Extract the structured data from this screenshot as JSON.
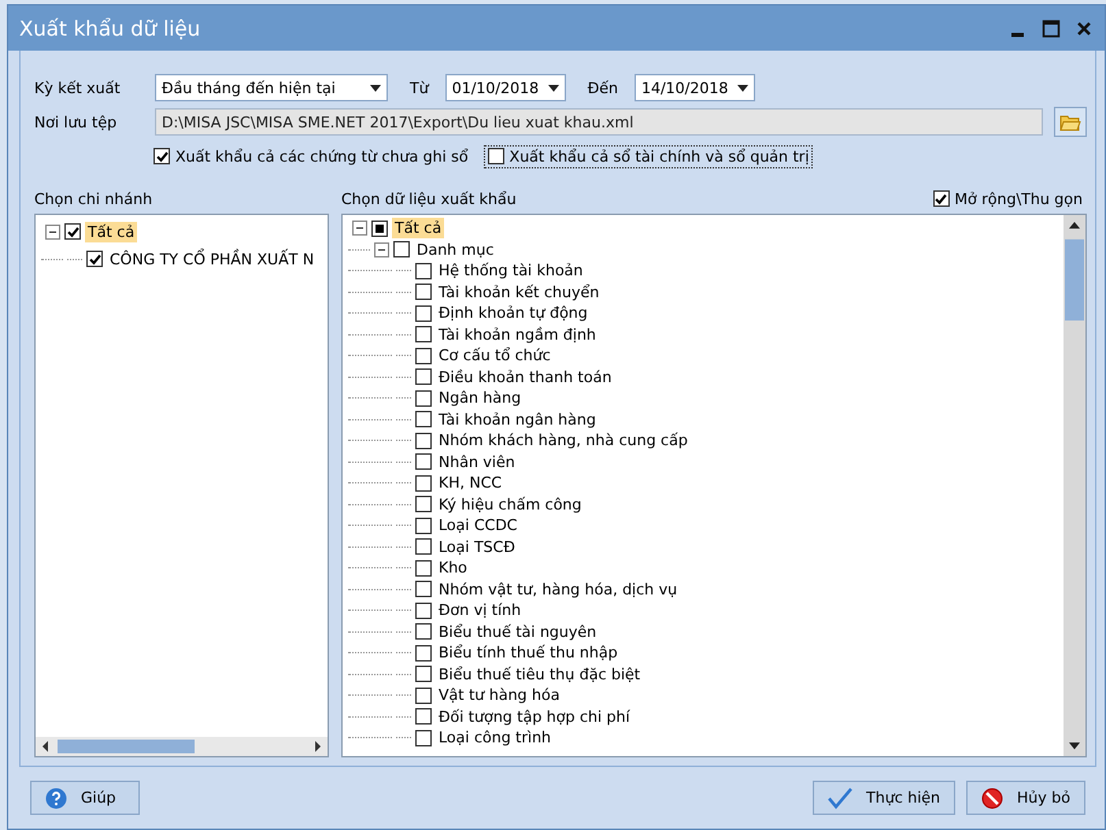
{
  "window": {
    "title": "Xuất khẩu dữ liệu"
  },
  "period": {
    "label": "Kỳ kết xuất",
    "value": "Đầu tháng đến hiện tại"
  },
  "from": {
    "label": "Từ",
    "value": "01/10/2018"
  },
  "to": {
    "label": "Đến",
    "value": "14/10/2018"
  },
  "save_path": {
    "label": "Nơi lưu tệp",
    "value": "D:\\MISA JSC\\MISA SME.NET 2017\\Export\\Du lieu xuat khau.xml"
  },
  "options": [
    {
      "label": "Xuất khẩu cả các chứng từ chưa ghi sổ",
      "checked": true,
      "focused": false
    },
    {
      "label": "Xuất khẩu cả sổ tài chính và sổ quản trị",
      "checked": false,
      "focused": true
    }
  ],
  "branches": {
    "title": "Chọn chi nhánh",
    "tree": [
      {
        "label": "Tất cả",
        "checked": true,
        "partial": false,
        "selected": true,
        "expanded": true,
        "children": [
          {
            "label": "CÔNG TY CỔ PHẦN XUẤT N",
            "checked": true,
            "partial": false,
            "selected": false
          }
        ]
      }
    ]
  },
  "data": {
    "title": "Chọn dữ liệu xuất khẩu",
    "expand_toggle": {
      "label": "Mở rộng\\Thu gọn",
      "checked": true
    },
    "tree": [
      {
        "label": "Tất cả",
        "checked": false,
        "partial": true,
        "selected": true,
        "expanded": true,
        "children": [
          {
            "label": "Danh mục",
            "checked": false,
            "partial": false,
            "selected": false,
            "expanded": true,
            "children": [
              {
                "label": "Hệ thống tài khoản",
                "checked": false,
                "partial": false,
                "selected": false
              },
              {
                "label": "Tài khoản kết chuyển",
                "checked": false,
                "partial": false,
                "selected": false
              },
              {
                "label": "Định khoản tự động",
                "checked": false,
                "partial": false,
                "selected": false
              },
              {
                "label": "Tài khoản ngầm định",
                "checked": false,
                "partial": false,
                "selected": false
              },
              {
                "label": "Cơ cấu tổ chức",
                "checked": false,
                "partial": false,
                "selected": false
              },
              {
                "label": "Điều khoản thanh toán",
                "checked": false,
                "partial": false,
                "selected": false
              },
              {
                "label": "Ngân hàng",
                "checked": false,
                "partial": false,
                "selected": false
              },
              {
                "label": "Tài khoản ngân hàng",
                "checked": false,
                "partial": false,
                "selected": false
              },
              {
                "label": "Nhóm khách hàng, nhà cung cấp",
                "checked": false,
                "partial": false,
                "selected": false
              },
              {
                "label": "Nhân viên",
                "checked": false,
                "partial": false,
                "selected": false
              },
              {
                "label": "KH, NCC",
                "checked": false,
                "partial": false,
                "selected": false
              },
              {
                "label": "Ký hiệu chấm công",
                "checked": false,
                "partial": false,
                "selected": false
              },
              {
                "label": "Loại CCDC",
                "checked": false,
                "partial": false,
                "selected": false
              },
              {
                "label": "Loại TSCĐ",
                "checked": false,
                "partial": false,
                "selected": false
              },
              {
                "label": "Kho",
                "checked": false,
                "partial": false,
                "selected": false
              },
              {
                "label": "Nhóm vật tư, hàng hóa, dịch vụ",
                "checked": false,
                "partial": false,
                "selected": false
              },
              {
                "label": "Đơn vị tính",
                "checked": false,
                "partial": false,
                "selected": false
              },
              {
                "label": "Biểu thuế tài nguyên",
                "checked": false,
                "partial": false,
                "selected": false
              },
              {
                "label": "Biểu tính thuế thu nhập",
                "checked": false,
                "partial": false,
                "selected": false
              },
              {
                "label": "Biểu thuế tiêu thụ đặc biệt",
                "checked": false,
                "partial": false,
                "selected": false
              },
              {
                "label": "Vật tư hàng hóa",
                "checked": false,
                "partial": false,
                "selected": false
              },
              {
                "label": "Đối tượng tập hợp chi phí",
                "checked": false,
                "partial": false,
                "selected": false
              },
              {
                "label": "Loại công trình",
                "checked": false,
                "partial": false,
                "selected": false
              }
            ]
          }
        ]
      }
    ]
  },
  "buttons": [
    {
      "kind": "help",
      "label": "Giúp"
    },
    {
      "kind": "ok",
      "label": "Thực hiện"
    },
    {
      "kind": "cancel",
      "label": "Hủy bỏ"
    }
  ]
}
